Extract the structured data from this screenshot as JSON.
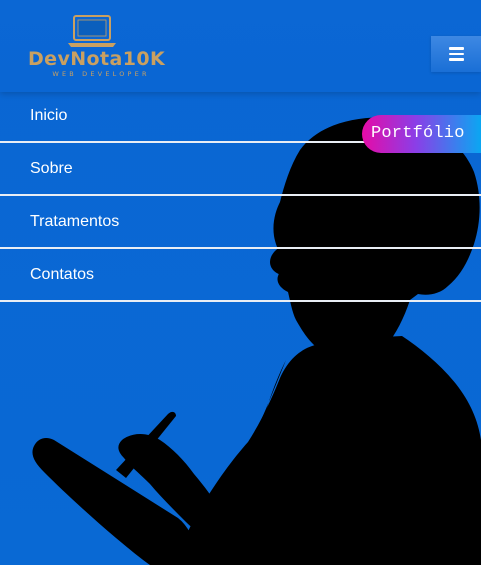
{
  "brand": {
    "name": "DevNota10K",
    "tagline": "WEB DEVELOPER",
    "gold": "#c9a061",
    "icon": "laptop-icon"
  },
  "header": {
    "menu_toggle_icon": "hamburger-menu-icon",
    "background": "#0a66d3"
  },
  "nav": {
    "items": [
      {
        "label": "Inicio"
      },
      {
        "label": "Sobre"
      },
      {
        "label": "Tratamentos"
      },
      {
        "label": "Contatos"
      }
    ]
  },
  "floating_button": {
    "label": "Portfólio",
    "gradient": [
      "#e60ba7",
      "#8b3ee7",
      "#0aa7f2"
    ]
  },
  "hero": {
    "image": "woman-with-pen-silhouette"
  }
}
